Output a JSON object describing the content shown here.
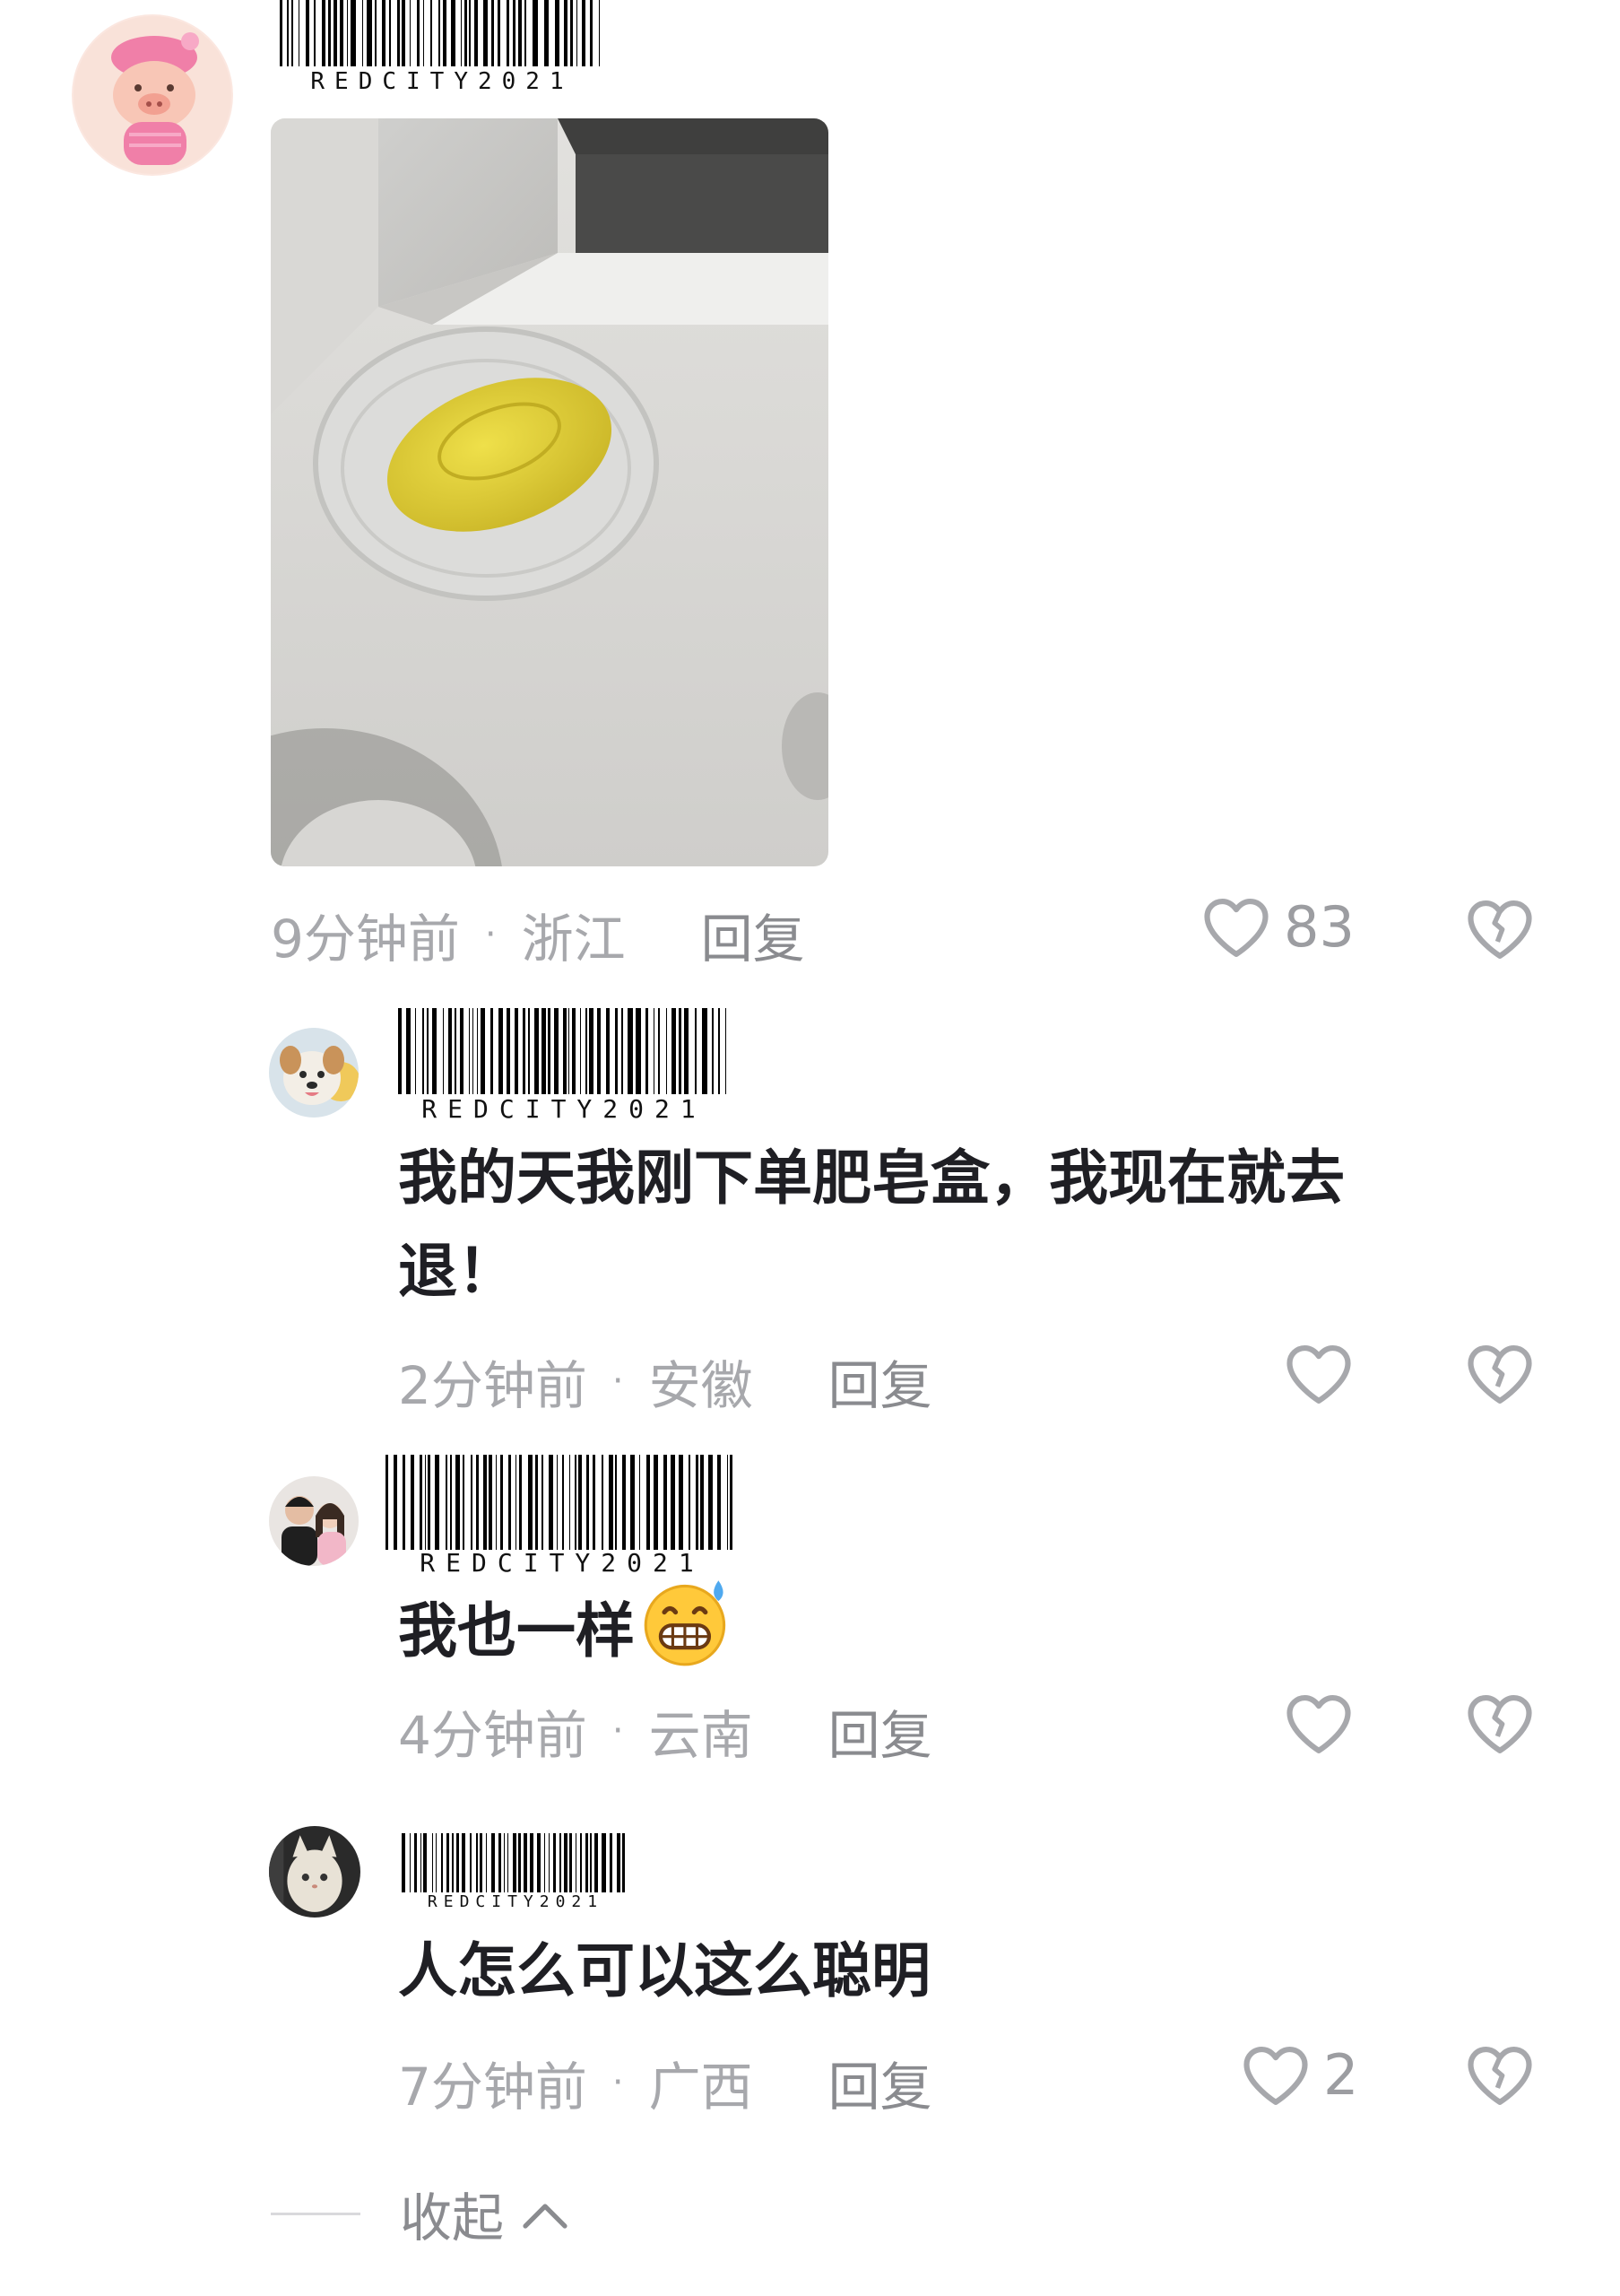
{
  "watermark_code": "REDCITY2021",
  "comments": [
    {
      "time": "9分钟前",
      "location": "浙江",
      "reply": "回复",
      "likes": "83"
    },
    {
      "text_line1": "我的天我刚下单肥皂盒，我现在就去",
      "text_line2": "退！",
      "time": "2分钟前",
      "location": "安徽",
      "reply": "回复"
    },
    {
      "text": "我也一样",
      "emoji": "grinning-sweat-emoji",
      "time": "4分钟前",
      "location": "云南",
      "reply": "回复"
    },
    {
      "text": "人怎么可以这么聪明",
      "time": "7分钟前",
      "location": "广西",
      "reply": "回复",
      "likes": "2"
    }
  ],
  "separator": "·",
  "collapse_label": "收起",
  "icons": {
    "like": "heart-outline-icon",
    "dislike": "broken-heart-icon",
    "collapse": "chevron-up-icon"
  },
  "colors": {
    "meta_text": "#a7a8ac",
    "comment_text": "#1f1f24",
    "soap": "#e6d538"
  }
}
